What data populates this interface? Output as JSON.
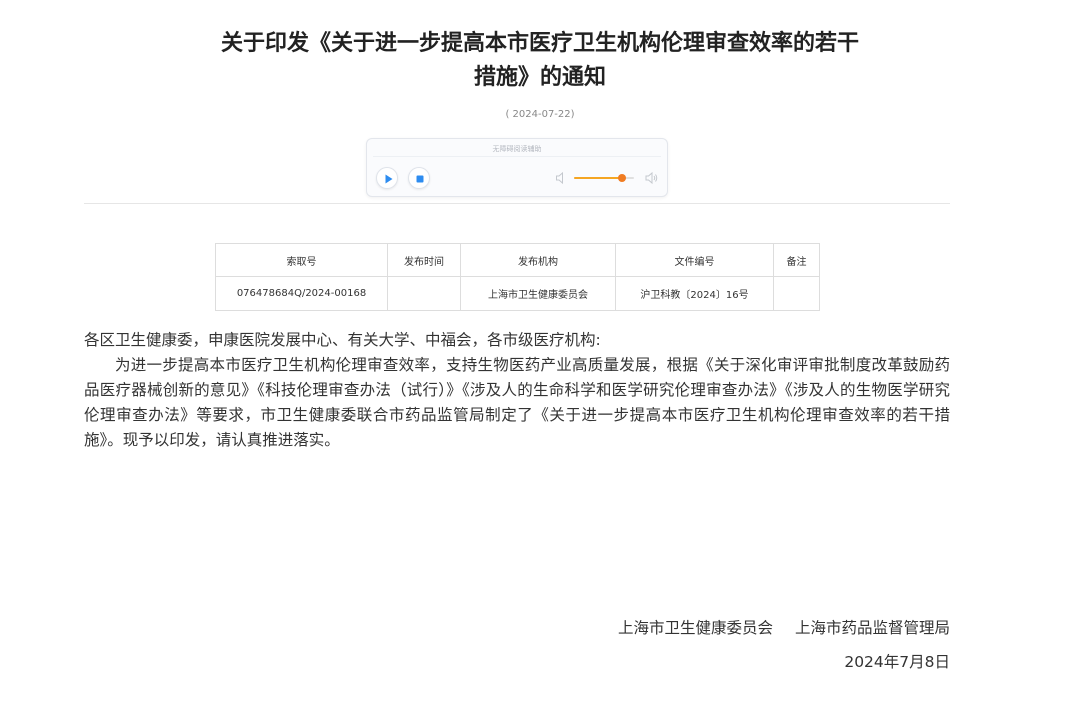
{
  "article": {
    "title_line1": "关于印发《关于进一步提高本市医疗卫生机构伦理审查效率的若干",
    "title_line2": "措施》的通知",
    "date": "( 2024-07-22)"
  },
  "player": {
    "caption": "无障碍阅读辅助",
    "play_icon": "play-icon",
    "stop_icon": "stop-icon",
    "volume_low_icon": "volume-low-icon",
    "volume_high_icon": "volume-high-icon",
    "volume_level": 0.8,
    "accent_color": "#f07c22"
  },
  "meta_table": {
    "headers": [
      "索取号",
      "发布时间",
      "发布机构",
      "文件编号",
      "备注"
    ],
    "row": [
      "076478684Q/2024-00168",
      "",
      "上海市卫生健康委员会",
      "沪卫科教〔2024〕16号",
      ""
    ]
  },
  "content": {
    "salutation": "各区卫生健康委，申康医院发展中心、有关大学、中福会，各市级医疗机构:",
    "paragraph": "为进一步提高本市医疗卫生机构伦理审查效率，支持生物医药产业高质量发展，根据《关于深化审评审批制度改革鼓励药品医疗器械创新的意见》《科技伦理审查办法（试行）》《涉及人的生命科学和医学研究伦理审查办法》《涉及人的生物医学研究伦理审查办法》等要求，市卫生健康委联合市药品监管局制定了《关于进一步提高本市医疗卫生机构伦理审查效率的若干措施》。现予以印发，请认真推进落实。"
  },
  "signature": {
    "org1": "上海市卫生健康委员会",
    "org2": "上海市药品监督管理局",
    "date": "2024年7月8日"
  }
}
